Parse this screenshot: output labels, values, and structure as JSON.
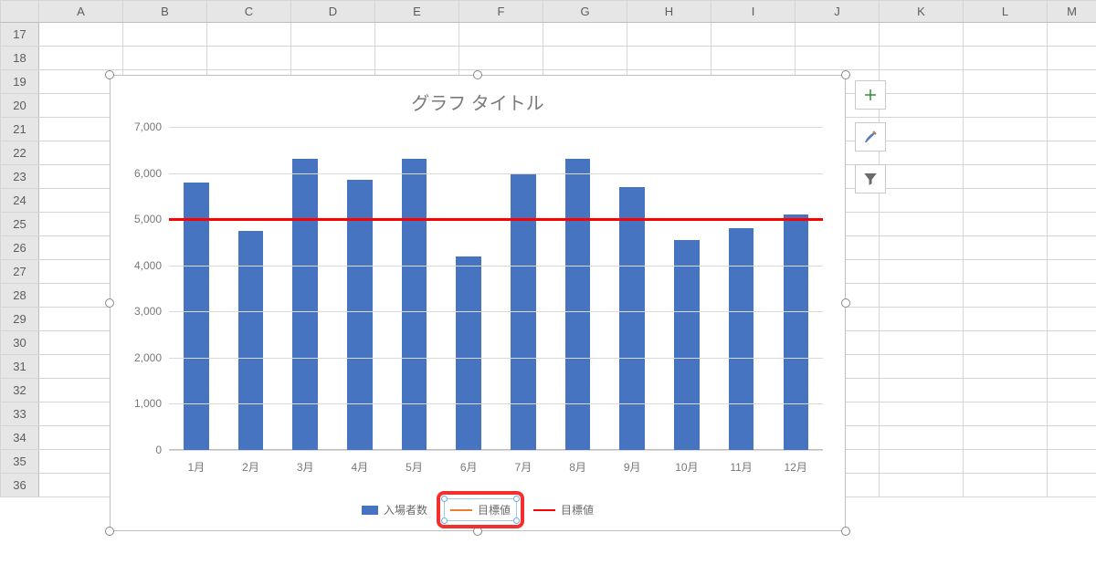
{
  "columns": [
    "A",
    "B",
    "C",
    "D",
    "E",
    "F",
    "G",
    "H",
    "I",
    "J",
    "K",
    "L",
    "M"
  ],
  "rows": [
    "17",
    "18",
    "19",
    "20",
    "21",
    "22",
    "23",
    "24",
    "25",
    "26",
    "27",
    "28",
    "29",
    "30",
    "31",
    "32",
    "33",
    "34",
    "35",
    "36"
  ],
  "chart_title": "グラフ タイトル",
  "legend": {
    "bar": "入場者数",
    "target_orange": "目標値",
    "target_red": "目標値"
  },
  "side_buttons": [
    "chart-elements",
    "chart-styles",
    "chart-filters"
  ],
  "chart_data": {
    "type": "bar",
    "categories": [
      "1月",
      "2月",
      "3月",
      "4月",
      "5月",
      "6月",
      "7月",
      "8月",
      "9月",
      "10月",
      "11月",
      "12月"
    ],
    "values": [
      5800,
      4750,
      6300,
      5850,
      6300,
      4200,
      6000,
      6300,
      5700,
      4550,
      4800,
      5100
    ],
    "series": [
      {
        "name": "入場者数",
        "type": "bar",
        "values": [
          5800,
          4750,
          6300,
          5850,
          6300,
          4200,
          6000,
          6300,
          5700,
          4550,
          4800,
          5100
        ],
        "color": "#4674c1"
      },
      {
        "name": "目標値",
        "type": "line",
        "constant": 5000,
        "color": "#ff0000"
      }
    ],
    "target_line": 5000,
    "title": "グラフ タイトル",
    "xlabel": "",
    "ylabel": "",
    "ylim": [
      0,
      7000
    ],
    "yticks": [
      0,
      1000,
      2000,
      3000,
      4000,
      5000,
      6000,
      7000
    ],
    "ytick_labels": [
      "0",
      "1,000",
      "2,000",
      "3,000",
      "4,000",
      "5,000",
      "6,000",
      "7,000"
    ]
  }
}
